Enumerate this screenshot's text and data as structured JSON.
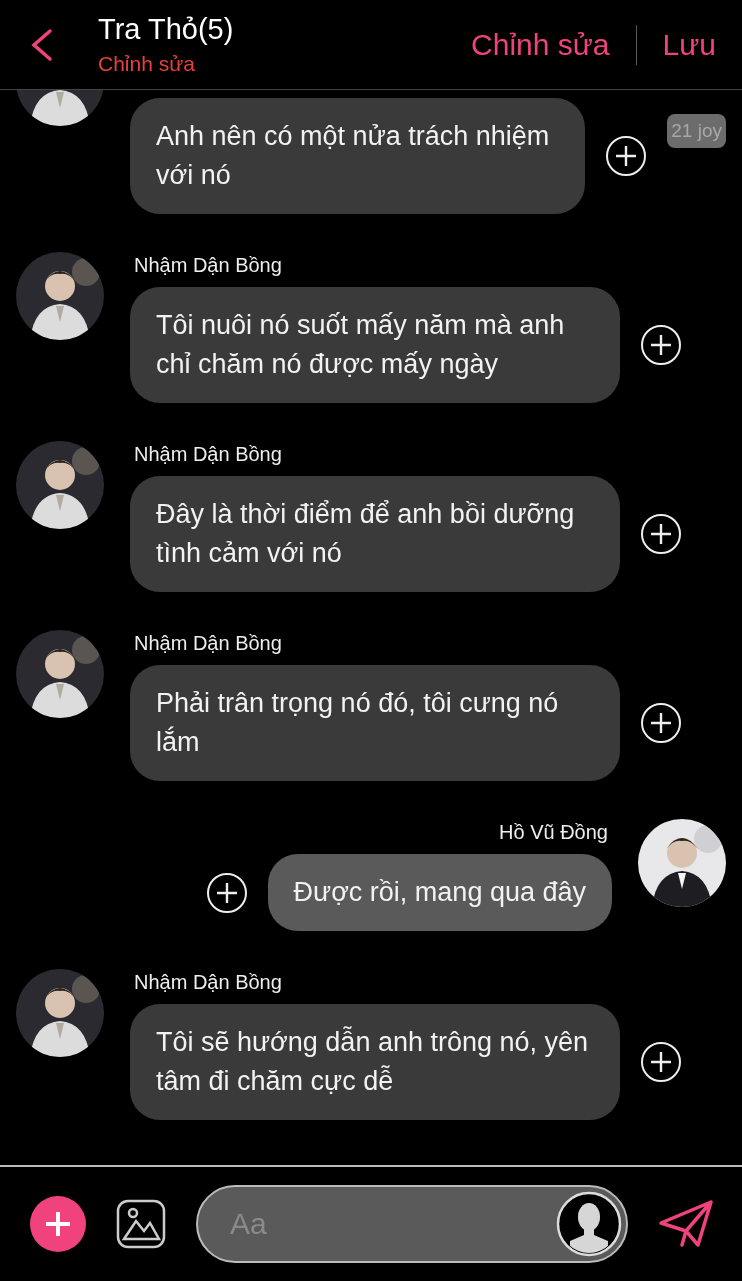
{
  "header": {
    "title": "Tra Thỏ(5)",
    "subtitle": "Chỉnh sửa",
    "actions": [
      "Chỉnh sửa",
      "Lưu"
    ]
  },
  "messages": [
    {
      "kind": "incoming",
      "text": "Anh nên có một nửa trách nhiệm với nó",
      "badge": "21 joy"
    },
    {
      "kind": "incoming",
      "sender": "Nhậm Dận Bồng",
      "text": "Tôi nuôi nó suốt mấy năm mà anh chỉ chăm nó được mấy ngày"
    },
    {
      "kind": "incoming",
      "sender": "Nhậm Dận Bồng",
      "text": "Đây là thời điểm để anh bồi dưỡng tình cảm với nó"
    },
    {
      "kind": "incoming",
      "sender": "Nhậm Dận Bồng",
      "text": "Phải trân trọng nó đó, tôi cưng nó lắm"
    },
    {
      "kind": "outgoing",
      "sender": "Hồ Vũ Đồng",
      "text": "Được rồi, mang qua đây"
    },
    {
      "kind": "incoming",
      "sender": "Nhậm Dận Bồng",
      "text": "Tôi sẽ hướng dẫn anh trông nó, yên tâm đi chăm cực dễ"
    }
  ],
  "composer": {
    "placeholder": "Aa"
  }
}
